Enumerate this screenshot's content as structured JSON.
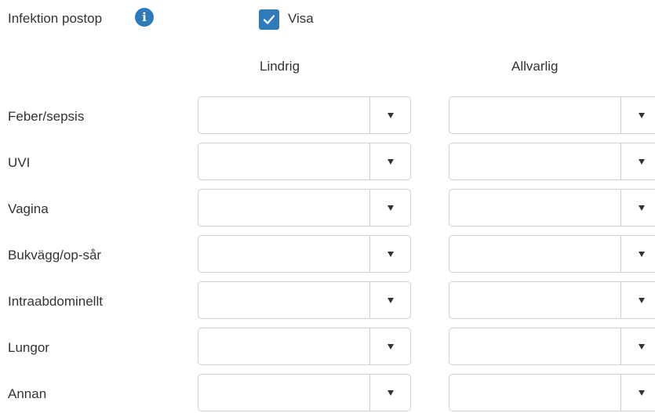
{
  "section": {
    "title": "Infektion postop",
    "info_icon": "info-icon",
    "show_checkbox": {
      "label": "Visa",
      "checked": true,
      "color": "#2f7ab8"
    }
  },
  "columns": {
    "lindrig": "Lindrig",
    "allvarlig": "Allvarlig"
  },
  "rows": [
    {
      "label": "Feber/sepsis",
      "lindrig": "",
      "allvarlig": ""
    },
    {
      "label": "UVI",
      "lindrig": "",
      "allvarlig": ""
    },
    {
      "label": "Vagina",
      "lindrig": "",
      "allvarlig": ""
    },
    {
      "label": "Bukvägg/op-sår",
      "lindrig": "",
      "allvarlig": ""
    },
    {
      "label": "Intraabdominellt",
      "lindrig": "",
      "allvarlig": ""
    },
    {
      "label": "Lungor",
      "lindrig": "",
      "allvarlig": ""
    },
    {
      "label": "Annan",
      "lindrig": "",
      "allvarlig": ""
    }
  ],
  "dropdown_icon": "chevron-down-icon"
}
